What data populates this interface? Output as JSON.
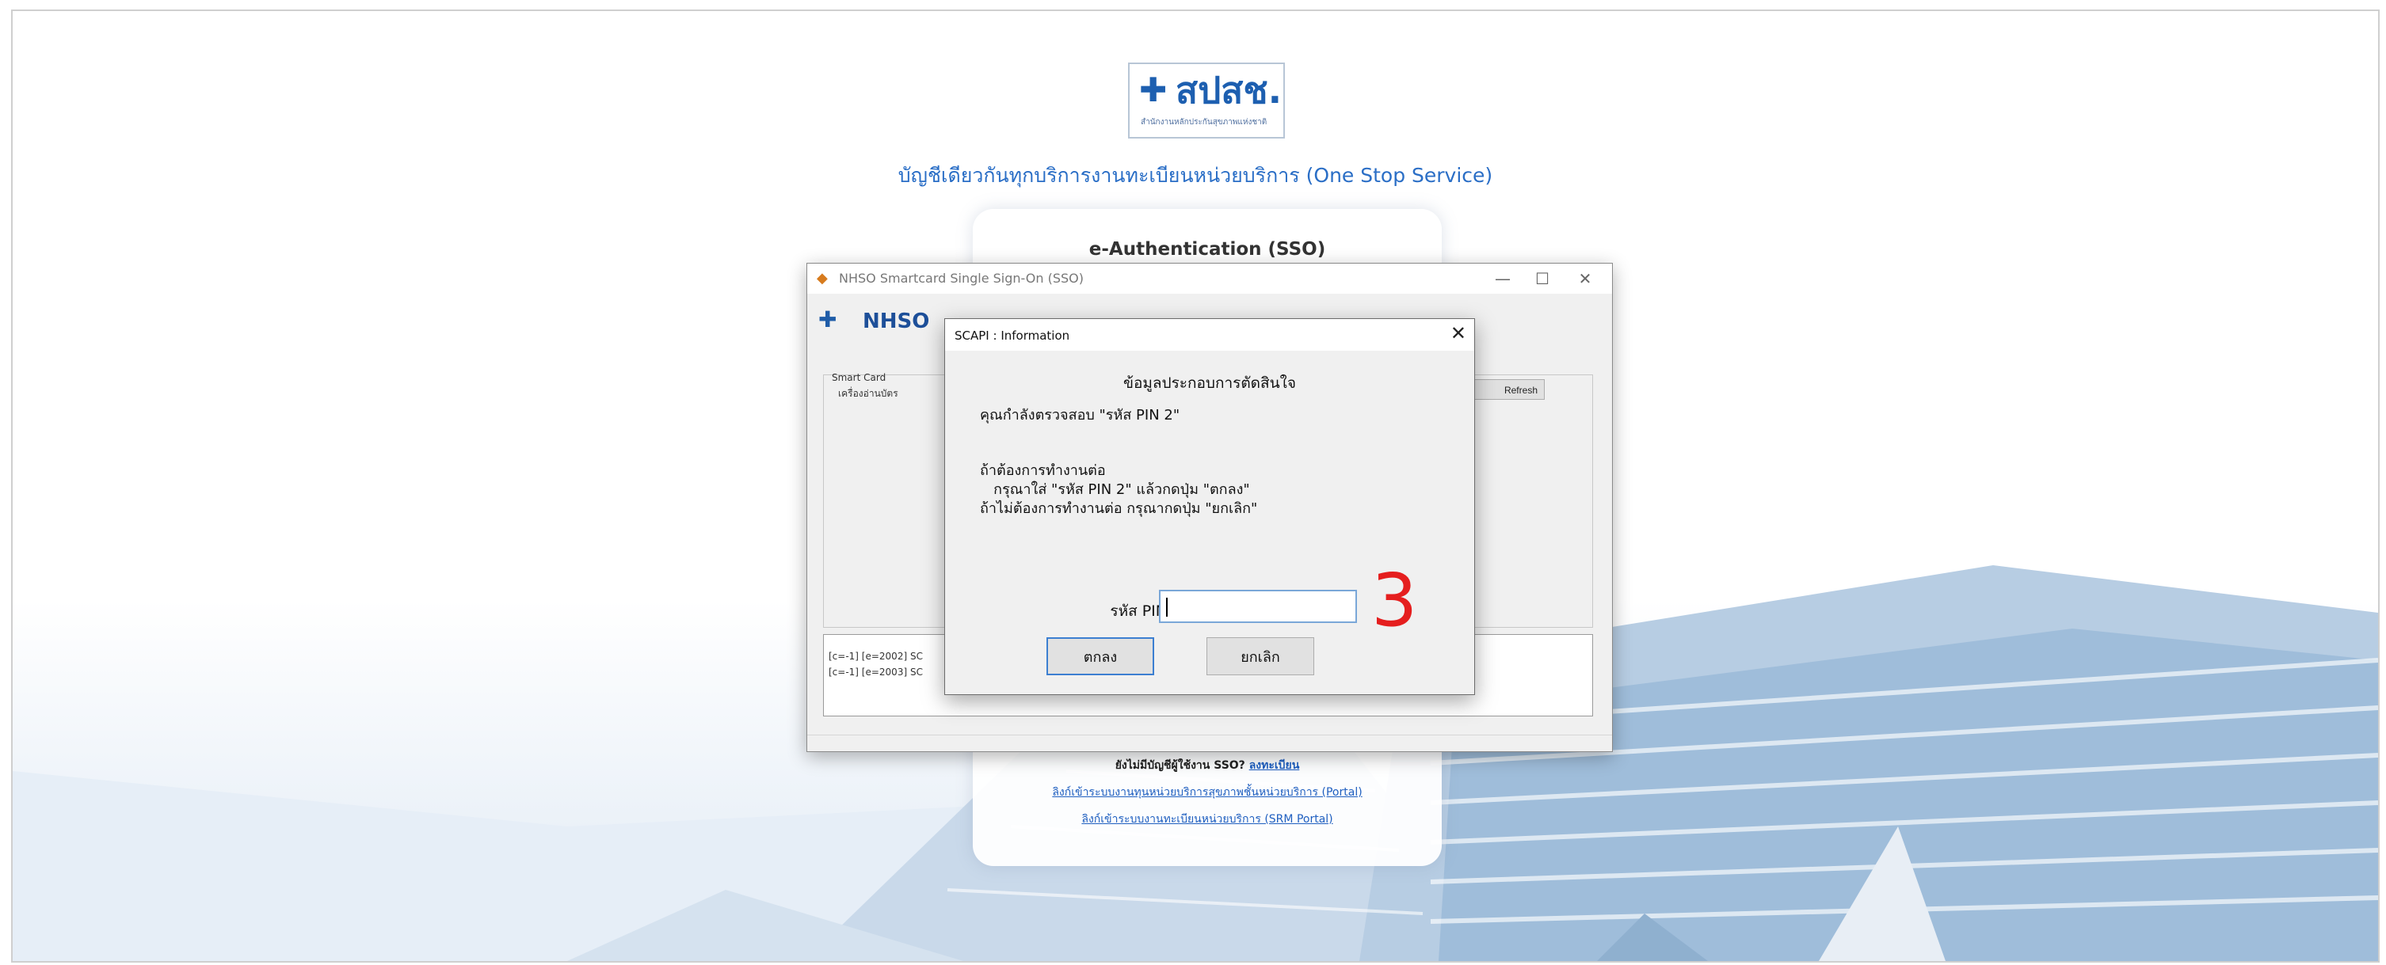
{
  "page": {
    "logo_text": "สปสช.",
    "logo_subtitle": "สำนักงานหลักประกันสุขภาพแห่งชาติ",
    "heading": "บัญชีเดียวกันทุกบริการงานทะเบียนหน่วยบริการ (One Stop Service)"
  },
  "login_card": {
    "title": "e-Authentication (SSO)",
    "footer_question": "ยังไม่มีบัญชีผู้ใช้งาน SSO?",
    "footer_register": "ลงทะเบียน",
    "link1": "ลิงก์เข้าระบบงานทุนหน่วยบริการสุขภาพชั้นหน่วยบริการ (Portal)",
    "link2": "ลิงก์เข้าระบบงานทะเบียนหน่วยบริการ (SRM Portal)"
  },
  "sso_window": {
    "title": "NHSO Smartcard Single Sign-On (SSO)",
    "banner": "NHSO",
    "group_label": "Smart Card",
    "reader_label": "เครื่องอ่านบัตร",
    "refresh_label": "Refresh",
    "log_lines": [
      "[c=-1] [e=2002] SC",
      "[c=-1] [e=2003] SC"
    ]
  },
  "dialog": {
    "title": "SCAPI : Information",
    "heading": "ข้อมูลประกอบการตัดสินใจ",
    "line1": "คุณกำลังตรวจสอบ \"รหัส PIN 2\"",
    "line2": "ถ้าต้องการทำงานต่อ",
    "line3": "   กรุณาใส่ \"รหัส PIN 2\" แล้วกดปุ่ม \"ตกลง\"",
    "line4": "ถ้าไม่ต้องการทำงานต่อ กรุณากดปุ่ม \"ยกเลิก\"",
    "pin_label": "รหัส PIN",
    "pin_value": "",
    "ok_label": "ตกลง",
    "cancel_label": "ยกเลิก"
  },
  "annotation": {
    "step_number": "3",
    "color": "#e51e1e"
  },
  "colors": {
    "brand": "#1d5fb0",
    "heading": "#2a6ec6",
    "link": "#1f5fc0"
  }
}
